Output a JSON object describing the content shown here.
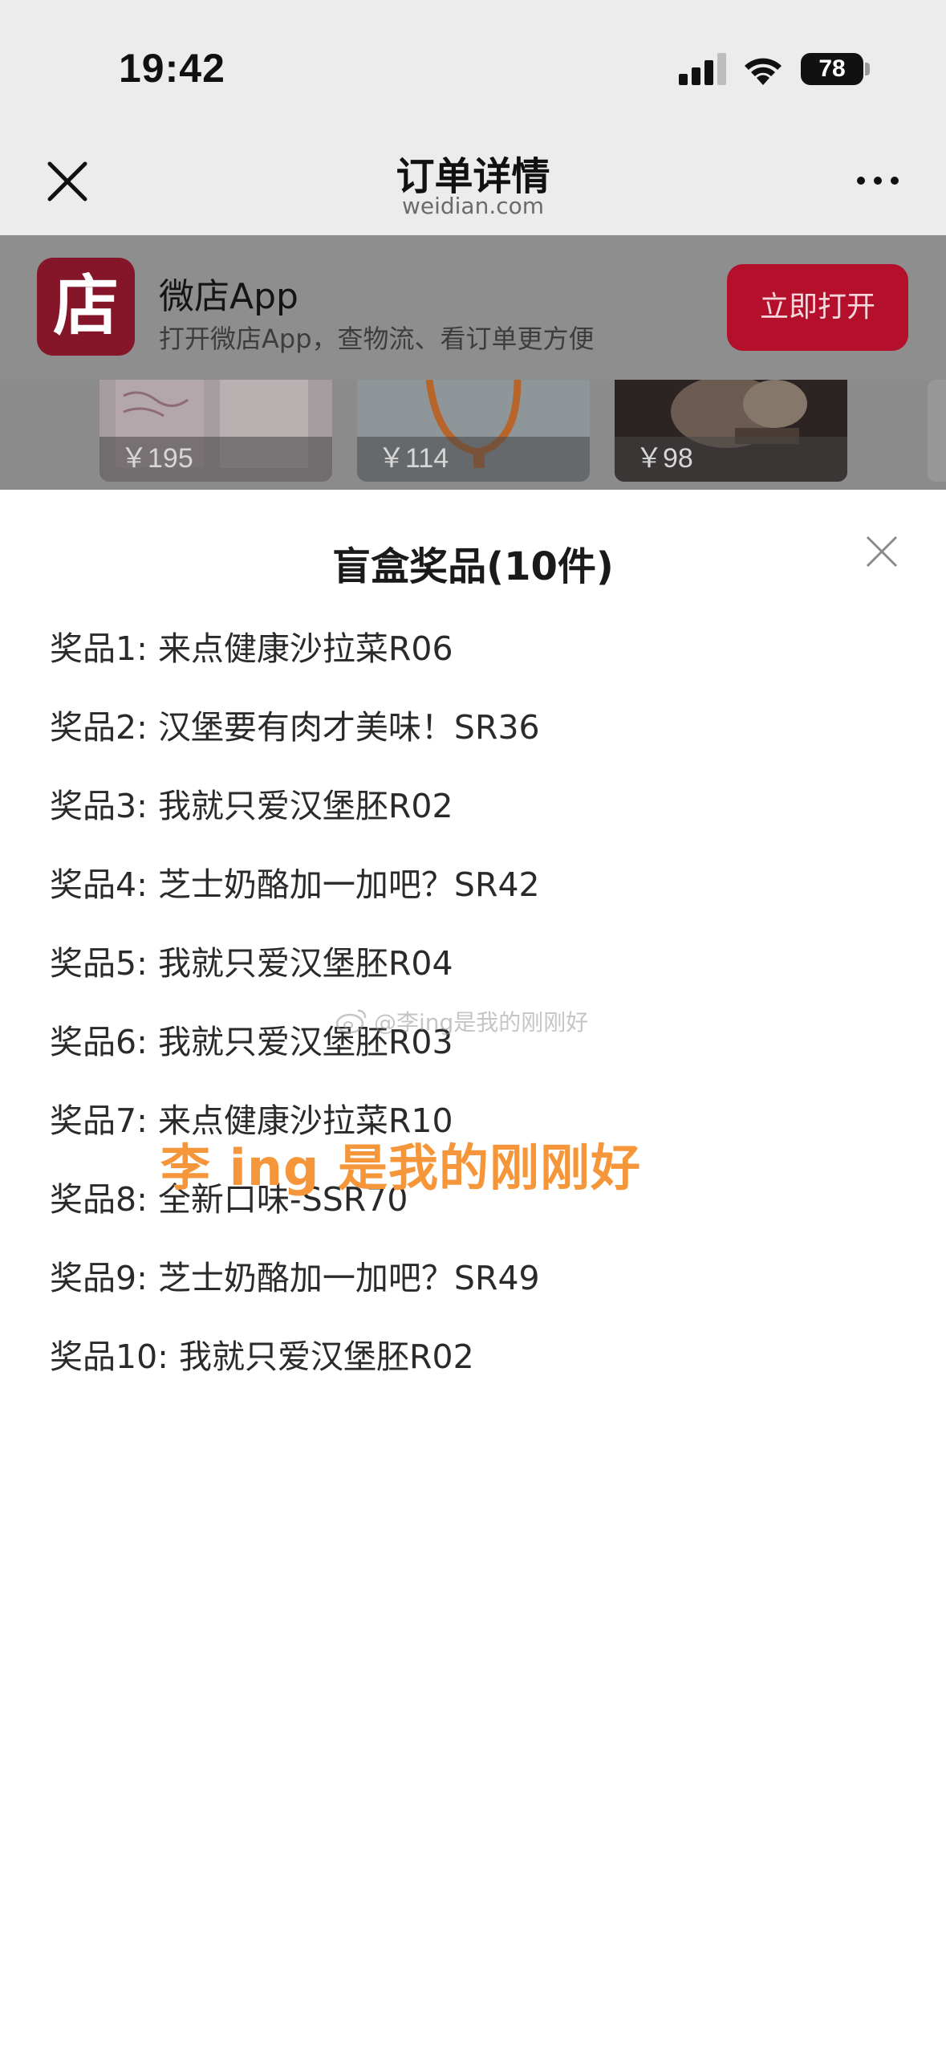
{
  "status_bar": {
    "time": "19:42",
    "battery": "78",
    "icons": [
      "cellular-signal-icon",
      "wifi-icon",
      "battery-icon"
    ]
  },
  "nav": {
    "title": "订单详情",
    "subtitle": "weidian.com",
    "icons": [
      "close-icon",
      "more-icon"
    ]
  },
  "app_banner": {
    "logo_char": "店",
    "name": "微店App",
    "description": "打开微店App，查物流、看订单更方便",
    "open_button": "立即打开",
    "colors": {
      "logo_bg": "#851629",
      "button_bg": "#b4102c"
    }
  },
  "products": [
    {
      "price": "￥195"
    },
    {
      "price": "￥114"
    },
    {
      "price": "￥98"
    }
  ],
  "sheet": {
    "title": "盲盒奖品(10件)",
    "prizes": [
      {
        "label": "奖品1: ",
        "name": "来点健康沙拉菜R06"
      },
      {
        "label": "奖品2: ",
        "name": "汉堡要有肉才美味！SR36"
      },
      {
        "label": "奖品3: ",
        "name": "我就只爱汉堡胚R02"
      },
      {
        "label": "奖品4: ",
        "name": "芝士奶酪加一加吧？SR42"
      },
      {
        "label": "奖品5: ",
        "name": "我就只爱汉堡胚R04"
      },
      {
        "label": "奖品6: ",
        "name": "我就只爱汉堡胚R03"
      },
      {
        "label": "奖品7: ",
        "name": "来点健康沙拉菜R10"
      },
      {
        "label": "奖品8: ",
        "name": "全新口味-SSR70"
      },
      {
        "label": "奖品9: ",
        "name": "芝士奶酪加一加吧？SR49"
      },
      {
        "label": "奖品10: ",
        "name": "我就只爱汉堡胚R02"
      }
    ]
  },
  "watermark": {
    "small": "@李ing是我的刚刚好",
    "big": "李 ing 是我的刚刚好",
    "color": "#f5963a"
  }
}
